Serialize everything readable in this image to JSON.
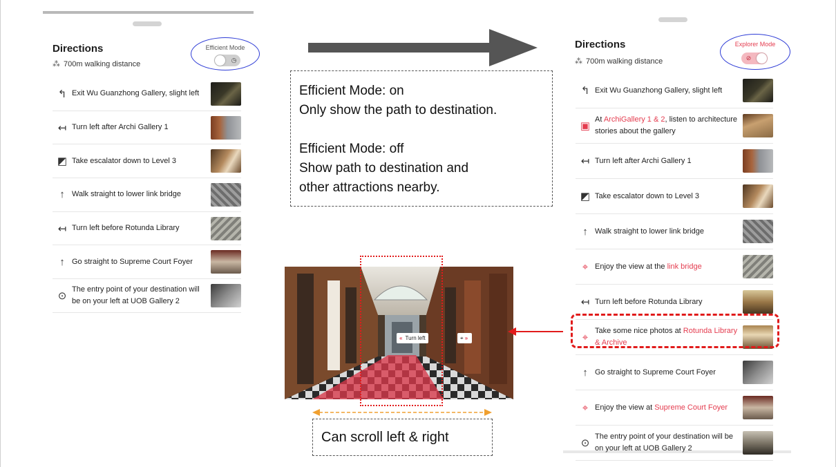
{
  "left_panel": {
    "title": "Directions",
    "distance": "700m walking distance",
    "mode_label": "Efficient Mode",
    "toggle_icon": "timer-icon",
    "steps": [
      {
        "icon": "slight-left-icon",
        "glyph": "↰",
        "text": "Exit Wu Guanzhong Gallery, slight left"
      },
      {
        "icon": "turn-left-icon",
        "glyph": "↤",
        "text": "Turn left after Archi Gallery 1"
      },
      {
        "icon": "escalator-icon",
        "glyph": "◩",
        "text": "Take escalator down to Level 3"
      },
      {
        "icon": "straight-icon",
        "glyph": "↑",
        "text": "Walk straight to lower link bridge"
      },
      {
        "icon": "turn-left-icon",
        "glyph": "↤",
        "text": "Turn left before Rotunda Library"
      },
      {
        "icon": "straight-icon",
        "glyph": "↑",
        "text": "Go straight to Supreme Court Foyer"
      },
      {
        "icon": "location-pin-icon",
        "glyph": "⊙",
        "text": "The entry point of your destination will be on your left at UOB Gallery 2"
      }
    ]
  },
  "right_panel": {
    "title": "Directions",
    "distance": "700m walking distance",
    "mode_label": "Explorer Mode",
    "toggle_icon": "compass-icon",
    "steps": [
      {
        "glyph": "↰",
        "pre": "Exit Wu Guanzhong Gallery, slight left",
        "hl": "",
        "post": ""
      },
      {
        "glyph": "▣",
        "pre": "At ",
        "hl": "ArchiGallery 1 & 2",
        "post": ", listen to architecture stories about the gallery"
      },
      {
        "glyph": "↤",
        "pre": "Turn left after Archi Gallery 1",
        "hl": "",
        "post": ""
      },
      {
        "glyph": "◩",
        "pre": "Take escalator down to Level 3",
        "hl": "",
        "post": ""
      },
      {
        "glyph": "↑",
        "pre": "Walk straight to lower link bridge",
        "hl": "",
        "post": ""
      },
      {
        "glyph": "⌖",
        "pre": "Enjoy the view at the ",
        "hl": "link bridge",
        "post": ""
      },
      {
        "glyph": "↤",
        "pre": "Turn left before Rotunda Library",
        "hl": "",
        "post": ""
      },
      {
        "glyph": "⌖",
        "pre": "Take some nice photos at ",
        "hl": "Rotunda Library & Archive",
        "post": ""
      },
      {
        "glyph": "↑",
        "pre": "Go straight to Supreme Court Foyer",
        "hl": "",
        "post": ""
      },
      {
        "glyph": "⌖",
        "pre": "Enjoy the view at ",
        "hl": "Supreme Court Foyer",
        "post": ""
      },
      {
        "glyph": "⊙",
        "pre": "The entry point of your destination will be on your left at UOB Gallery 2",
        "hl": "",
        "post": ""
      }
    ]
  },
  "note": {
    "line1": "Efficient Mode: on",
    "line2": "Only show the path to destination.",
    "line3": "Efficient Mode: off",
    "line4": "Show path to destination and",
    "line5": "other attractions nearby."
  },
  "panorama": {
    "turn_label": "Turn left"
  },
  "scroll_note": "Can scroll left & right",
  "colors": {
    "accent_red": "#e43c4f",
    "annotation_blue": "#2d3bd6",
    "annotation_orange": "#f0a030"
  }
}
